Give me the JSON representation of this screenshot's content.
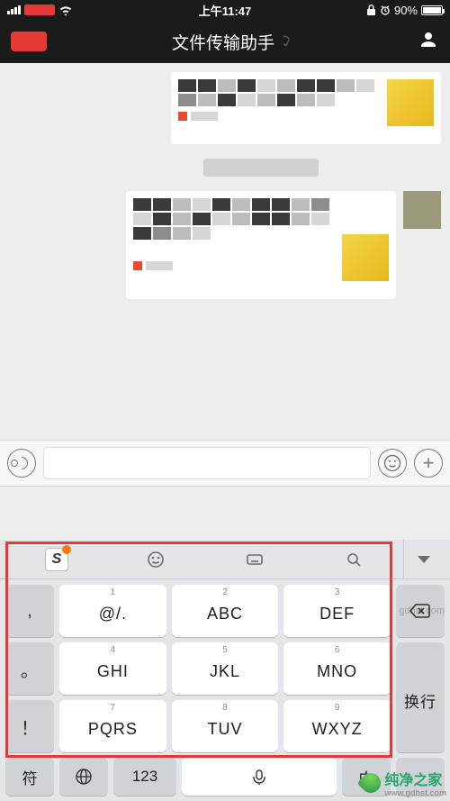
{
  "status": {
    "time": "上午11:47",
    "battery_pct": "90%",
    "wifi": true,
    "lock": true,
    "alarm": true
  },
  "nav": {
    "title": "文件传输助手",
    "earpiece_icon": "ear"
  },
  "chat": {
    "timestamp_placeholder": "　　　　"
  },
  "keyboard": {
    "left_side": [
      ",",
      "。",
      "！"
    ],
    "keys": [
      {
        "n": "1",
        "t": "@/."
      },
      {
        "n": "2",
        "t": "ABC"
      },
      {
        "n": "3",
        "t": "DEF"
      },
      {
        "n": "4",
        "t": "GHI"
      },
      {
        "n": "5",
        "t": "JKL"
      },
      {
        "n": "6",
        "t": "MNO"
      },
      {
        "n": "7",
        "t": "PQRS"
      },
      {
        "n": "8",
        "t": "TUV"
      },
      {
        "n": "9",
        "t": "WXYZ"
      }
    ],
    "right_side": {
      "backspace": "⌫",
      "enter": "换行"
    },
    "bottom": {
      "sym": "符",
      "num": "123",
      "cn": "中"
    }
  },
  "watermark": {
    "line1": "gdhst.com",
    "brand": "纯净之家",
    "sub": "www.gdhst.com"
  }
}
